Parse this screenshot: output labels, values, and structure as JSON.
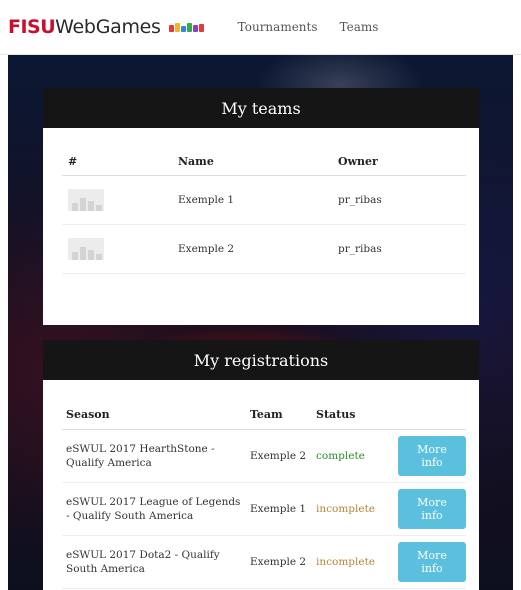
{
  "header": {
    "brand_fisu": "FISU",
    "brand_rest": "WebGames",
    "nav": [
      {
        "label": "Tournaments"
      },
      {
        "label": "Teams"
      }
    ]
  },
  "my_teams": {
    "title": "My teams",
    "columns": [
      "#",
      "Name",
      "Owner"
    ],
    "rows": [
      {
        "name": "Exemple 1",
        "owner": "pr_ribas"
      },
      {
        "name": "Exemple 2",
        "owner": "pr_ribas"
      }
    ]
  },
  "my_registrations": {
    "title": "My registrations",
    "columns": [
      "Season",
      "Team",
      "Status",
      ""
    ],
    "rows": [
      {
        "season": "eSWUL 2017 HearthStone - Qualify America",
        "team": "Exemple 2",
        "status": "complete",
        "action": "More info"
      },
      {
        "season": "eSWUL 2017 League of Legends - Qualify South America",
        "team": "Exemple 1",
        "status": "incomplete",
        "action": "More info"
      },
      {
        "season": "eSWUL 2017 Dota2 - Qualify South America",
        "team": "Exemple 2",
        "status": "incomplete",
        "action": "More info"
      }
    ]
  },
  "colors": {
    "accent_button": "#5bc0de",
    "status_complete": "#2e8b2e",
    "status_incomplete": "#b8863b",
    "brand_red": "#c8102e"
  }
}
